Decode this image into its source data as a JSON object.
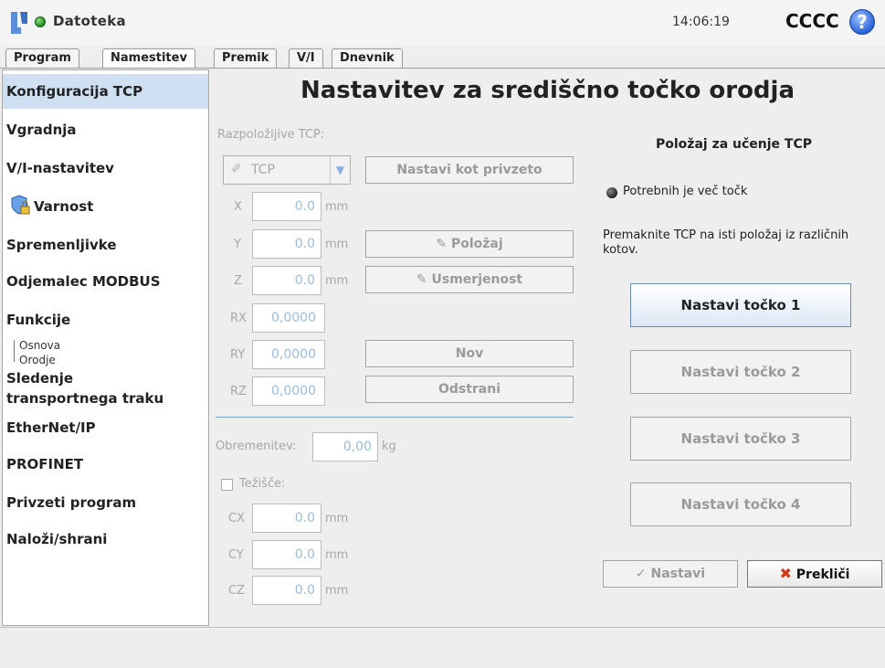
{
  "header": {
    "file_menu": "Datoteka",
    "time": "14:06:19",
    "robot_name": "CCCC",
    "help": "?"
  },
  "tabs": [
    "Program",
    "Namestitev",
    "Premik",
    "V/I",
    "Dnevnik"
  ],
  "sidebar": {
    "items": [
      "Konfiguracija TCP",
      "Vgradnja",
      "V/I-nastavitev",
      "Varnost",
      "Spremenljivke",
      "Odjemalec MODBUS",
      "Funkcije",
      "Sledenje transportnega traku",
      "EtherNet/IP",
      "PROFINET",
      "Privzeti program",
      "Naloži/shrani"
    ],
    "funkcije_sub": [
      "Osnova",
      "Orodje"
    ],
    "sledenje_lines": [
      "Sledenje",
      "transportnega traku"
    ]
  },
  "main": {
    "title": "Nastavitev za središčno točko orodja",
    "available_tcp_label": "Razpoložljive TCP:",
    "tcp_select": "TCP",
    "set_default_button": "Nastavi kot privzeto",
    "pose": {
      "x": {
        "label": "X",
        "value": "0.0",
        "unit": "mm"
      },
      "y": {
        "label": "Y",
        "value": "0.0",
        "unit": "mm"
      },
      "z": {
        "label": "Z",
        "value": "0.0",
        "unit": "mm"
      },
      "rx": {
        "label": "RX",
        "value": "0,0000"
      },
      "ry": {
        "label": "RY",
        "value": "0,0000"
      },
      "rz": {
        "label": "RZ",
        "value": "0,0000"
      }
    },
    "position_button": "Položaj",
    "orientation_button": "Usmerjenost",
    "new_button": "Nov",
    "remove_button": "Odstrani",
    "payload": {
      "label": "Obremenitev:",
      "value": "0,00",
      "unit": "kg"
    },
    "cog": {
      "label": "Težišče:",
      "cx": {
        "label": "CX",
        "value": "0.0",
        "unit": "mm"
      },
      "cy": {
        "label": "CY",
        "value": "0.0",
        "unit": "mm"
      },
      "cz": {
        "label": "CZ",
        "value": "0.0",
        "unit": "mm"
      }
    },
    "teach": {
      "title": "Položaj za učenje TCP",
      "status": "Potrebnih je več točk",
      "instruction": "Premaknite TCP na isti položaj iz različnih kotov.",
      "points": [
        "Nastavi točko 1",
        "Nastavi točko 2",
        "Nastavi točko 3",
        "Nastavi točko 4"
      ],
      "set_button": "Nastavi",
      "cancel_button": "Prekliči"
    }
  },
  "colors": {
    "accent": "#cfe0f3",
    "disabled_text": "#9a9a9a",
    "field_text": "#9bbcdf",
    "cancel_x": "#d83a16"
  }
}
